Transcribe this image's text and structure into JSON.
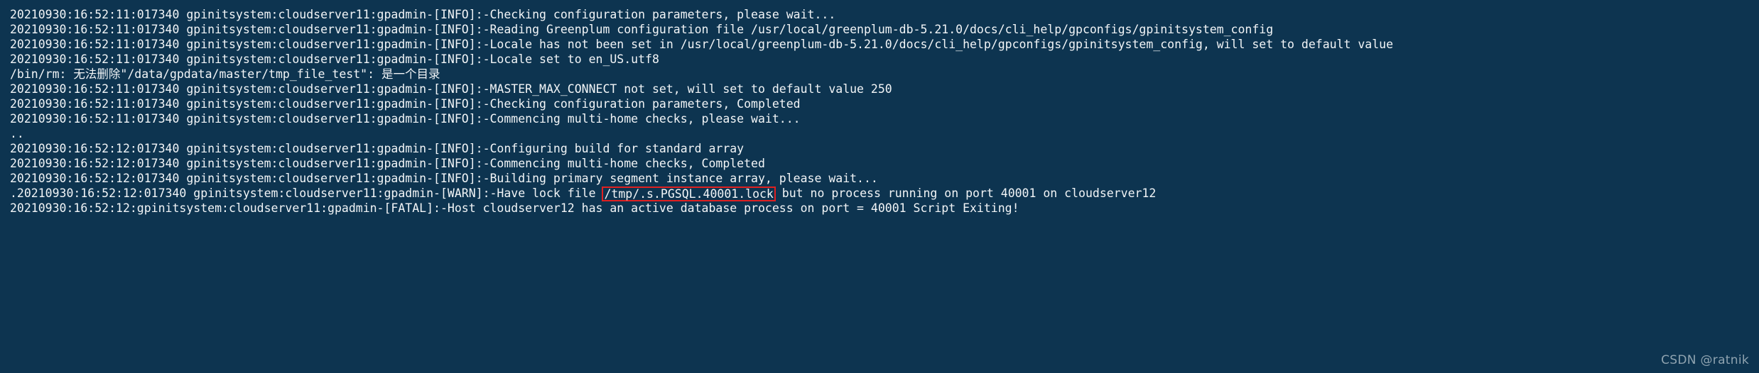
{
  "terminal": {
    "background_color": "#0d3450",
    "text_color": "#f2f5f7",
    "highlight_border_color": "#e02020",
    "lines": [
      {
        "id": "line-1",
        "text": "20210930:16:52:11:017340 gpinitsystem:cloudserver11:gpadmin-[INFO]:-Checking configuration parameters, please wait..."
      },
      {
        "id": "line-2",
        "text": "20210930:16:52:11:017340 gpinitsystem:cloudserver11:gpadmin-[INFO]:-Reading Greenplum configuration file /usr/local/greenplum-db-5.21.0/docs/cli_help/gpconfigs/gpinitsystem_config"
      },
      {
        "id": "line-3",
        "text": "20210930:16:52:11:017340 gpinitsystem:cloudserver11:gpadmin-[INFO]:-Locale has not been set in /usr/local/greenplum-db-5.21.0/docs/cli_help/gpconfigs/gpinitsystem_config, will set to default value"
      },
      {
        "id": "line-4",
        "text": "20210930:16:52:11:017340 gpinitsystem:cloudserver11:gpadmin-[INFO]:-Locale set to en_US.utf8"
      },
      {
        "id": "line-5",
        "text": "/bin/rm: 无法删除\"/data/gpdata/master/tmp_file_test\": 是一个目录"
      },
      {
        "id": "line-6",
        "text": "20210930:16:52:11:017340 gpinitsystem:cloudserver11:gpadmin-[INFO]:-MASTER_MAX_CONNECT not set, will set to default value 250"
      },
      {
        "id": "line-7",
        "text": "20210930:16:52:11:017340 gpinitsystem:cloudserver11:gpadmin-[INFO]:-Checking configuration parameters, Completed"
      },
      {
        "id": "line-8",
        "text": "20210930:16:52:11:017340 gpinitsystem:cloudserver11:gpadmin-[INFO]:-Commencing multi-home checks, please wait..."
      },
      {
        "id": "line-9",
        "text": ".."
      },
      {
        "id": "line-10",
        "text": "20210930:16:52:12:017340 gpinitsystem:cloudserver11:gpadmin-[INFO]:-Configuring build for standard array"
      },
      {
        "id": "line-11",
        "text": "20210930:16:52:12:017340 gpinitsystem:cloudserver11:gpadmin-[INFO]:-Commencing multi-home checks, Completed"
      },
      {
        "id": "line-12",
        "text": "20210930:16:52:12:017340 gpinitsystem:cloudserver11:gpadmin-[INFO]:-Building primary segment instance array, please wait..."
      }
    ],
    "warn_line": {
      "id": "line-13",
      "prefix": ".20210930:16:52:12:017340 gpinitsystem:cloudserver11:gpadmin-[WARN]:-Have lock file ",
      "highlighted": "/tmp/.s.PGSQL.40001.lock",
      "suffix": " but no process running on port 40001 on cloudserver12"
    },
    "fatal_line": {
      "id": "line-14",
      "text": "20210930:16:52:12:gpinitsystem:cloudserver11:gpadmin-[FATAL]:-Host cloudserver12 has an active database process on port = 40001 Script Exiting!"
    }
  },
  "watermark": {
    "text": "CSDN @ratnik"
  }
}
